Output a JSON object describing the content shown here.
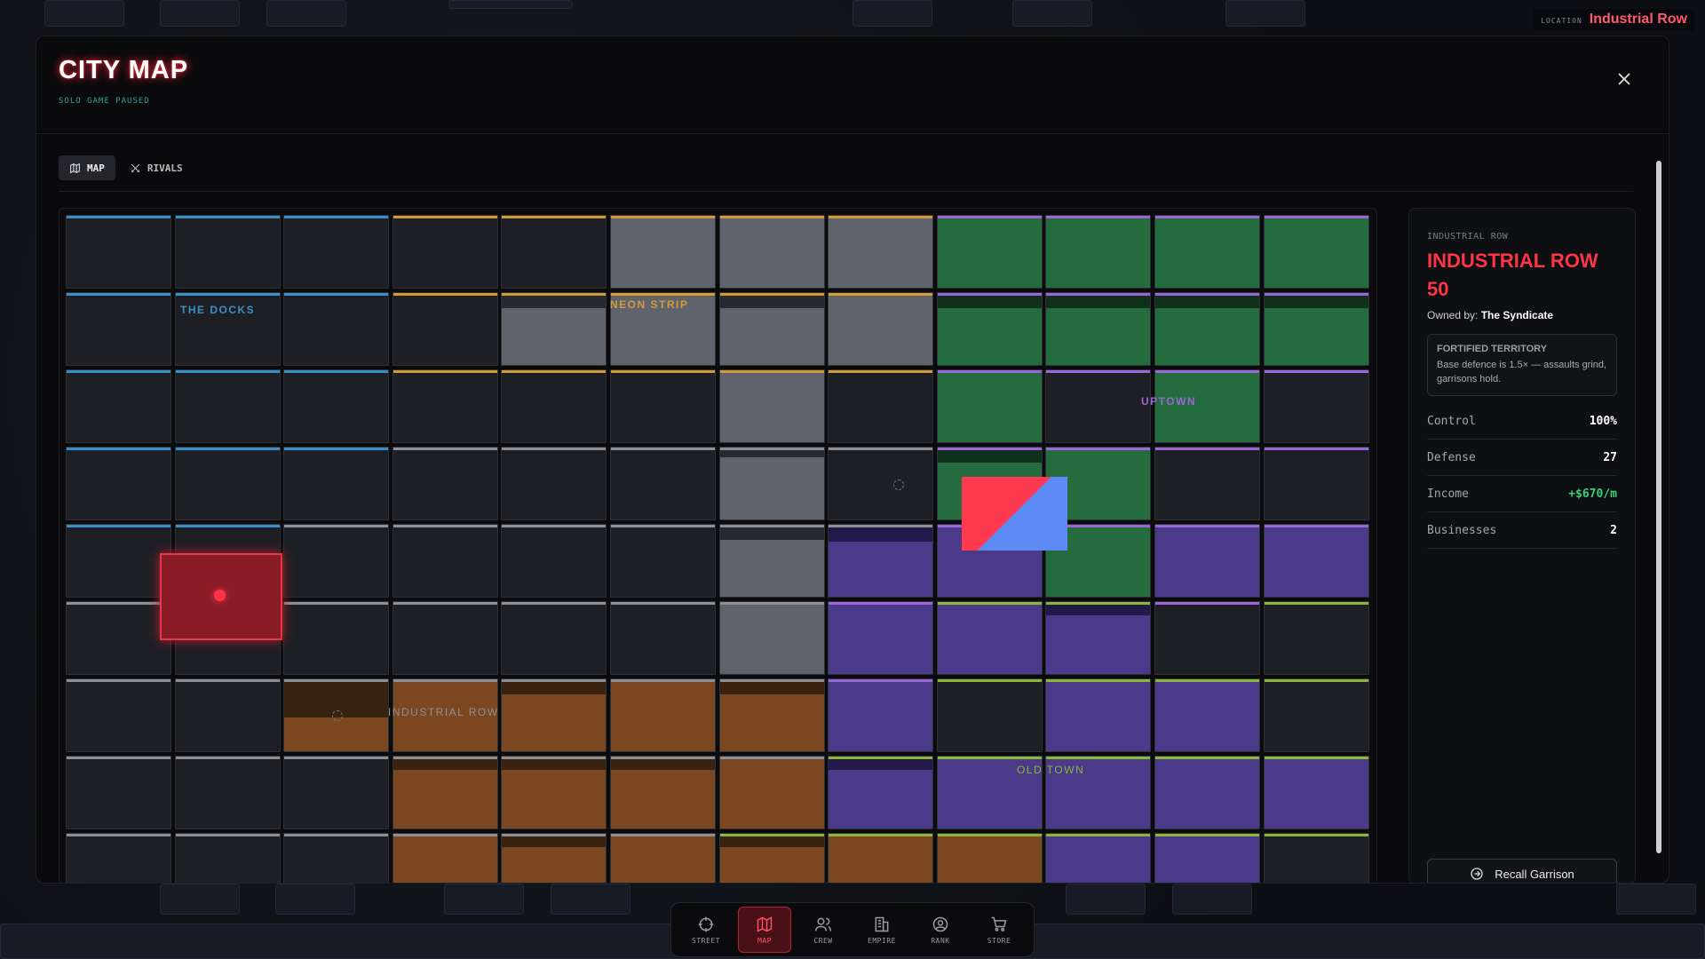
{
  "location": {
    "key": "LOCATION",
    "value": "Industrial Row"
  },
  "modal": {
    "title": "CITY MAP",
    "subtitle": "SOLO GAME PAUSED",
    "close": "×"
  },
  "tabs": [
    {
      "label": "MAP",
      "active": true
    },
    {
      "label": "RIVALS",
      "active": false
    }
  ],
  "districts": [
    {
      "label": "THE DOCKS",
      "color": "#3b8fc9"
    },
    {
      "label": "NEON STRIP",
      "color": "#d49a3a"
    },
    {
      "label": "UPTOWN",
      "color": "#9a67d9"
    },
    {
      "label": "INDUSTRIAL ROW",
      "color": "#8e8f94"
    },
    {
      "label": "OLD TOWN",
      "color": "#8ab63a"
    }
  ],
  "colors": {
    "gray": "#5e636c",
    "green": "#246b3d",
    "purple": "#4b3a8a",
    "orange": "#7a4720",
    "empty": "#1d1f24",
    "player": "#8a1c28",
    "accent": "#ff3446"
  },
  "grid": {
    "rows": 9,
    "cols": 12,
    "district_map": [
      "DDDNNNNNGGGG",
      "DDDNNNNNGGGG",
      "DDDNNNNNGUGU",
      "DDDIIIIIGGUU",
      "DDIIIIIIUGUU",
      "IIIIIIIUOOUO",
      "IIIIIIIUOOOO",
      "IIIIIIIOOOOO",
      "IIIIIIOOOOOO"
    ],
    "owner_map": [
      ".....sss....",
      "....ssss....",
      "......s.....",
      "......s.....",
      "......sppgpp",
      "......sppp..",
      "..ooooop.pp.",
      "...ooooppppp",
      "...oooooopp."
    ],
    "band_map": [
      "............",
      "....1.1.1111",
      "............",
      "......0.1...",
      "......1p....",
      ".........2..",
      "..5.1.1.....",
      "...222.2....",
      "....2.2....."
    ],
    "green_map": [
      "........gggg",
      "........gggg",
      "........g.g.",
      "........gg..",
      ".........g..",
      "............",
      "............",
      "............",
      "............"
    ]
  },
  "panel": {
    "kicker": "INDUSTRIAL ROW",
    "name": "INDUSTRIAL ROW 50",
    "owned_prefix": "Owned by:",
    "owner": "The Syndicate",
    "fortified_title": "FORTIFIED TERRITORY",
    "fortified_desc": "Base defence is 1.5× — assaults grind, garrisons hold.",
    "stats": [
      {
        "label": "Control",
        "value": "100%"
      },
      {
        "label": "Defense",
        "value": "27"
      },
      {
        "label": "Income",
        "value": "+$670/m"
      },
      {
        "label": "Businesses",
        "value": "2"
      }
    ],
    "recall": "Recall Garrison"
  },
  "nav": [
    {
      "label": "STREET",
      "icon": "crosshair-icon",
      "active": false
    },
    {
      "label": "MAP",
      "icon": "map-icon",
      "active": true
    },
    {
      "label": "CREW",
      "icon": "users-icon",
      "active": false
    },
    {
      "label": "EMPIRE",
      "icon": "building-icon",
      "active": false
    },
    {
      "label": "RANK",
      "icon": "user-circle-icon",
      "active": false
    },
    {
      "label": "STORE",
      "icon": "cart-icon",
      "active": false
    }
  ]
}
